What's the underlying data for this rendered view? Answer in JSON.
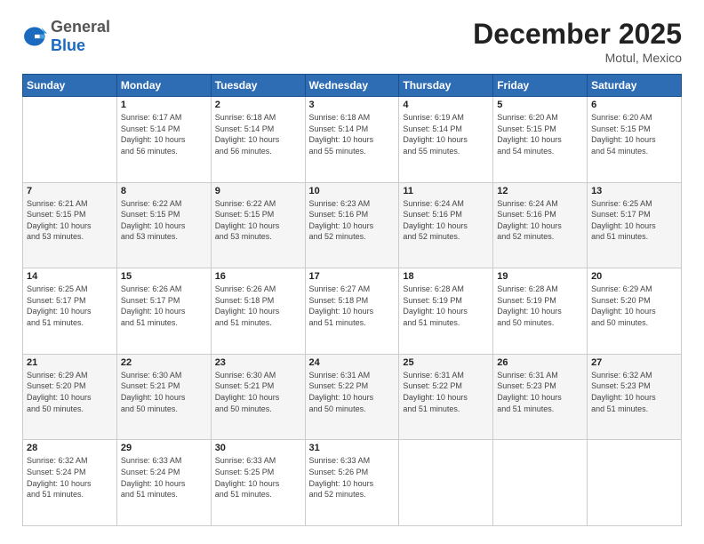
{
  "header": {
    "logo": {
      "general": "General",
      "blue": "Blue"
    },
    "title": "December 2025",
    "subtitle": "Motul, Mexico"
  },
  "weekdays": [
    "Sunday",
    "Monday",
    "Tuesday",
    "Wednesday",
    "Thursday",
    "Friday",
    "Saturday"
  ],
  "weeks": [
    [
      {
        "day": "",
        "info": ""
      },
      {
        "day": "1",
        "info": "Sunrise: 6:17 AM\nSunset: 5:14 PM\nDaylight: 10 hours\nand 56 minutes."
      },
      {
        "day": "2",
        "info": "Sunrise: 6:18 AM\nSunset: 5:14 PM\nDaylight: 10 hours\nand 56 minutes."
      },
      {
        "day": "3",
        "info": "Sunrise: 6:18 AM\nSunset: 5:14 PM\nDaylight: 10 hours\nand 55 minutes."
      },
      {
        "day": "4",
        "info": "Sunrise: 6:19 AM\nSunset: 5:14 PM\nDaylight: 10 hours\nand 55 minutes."
      },
      {
        "day": "5",
        "info": "Sunrise: 6:20 AM\nSunset: 5:15 PM\nDaylight: 10 hours\nand 54 minutes."
      },
      {
        "day": "6",
        "info": "Sunrise: 6:20 AM\nSunset: 5:15 PM\nDaylight: 10 hours\nand 54 minutes."
      }
    ],
    [
      {
        "day": "7",
        "info": "Sunrise: 6:21 AM\nSunset: 5:15 PM\nDaylight: 10 hours\nand 53 minutes."
      },
      {
        "day": "8",
        "info": "Sunrise: 6:22 AM\nSunset: 5:15 PM\nDaylight: 10 hours\nand 53 minutes."
      },
      {
        "day": "9",
        "info": "Sunrise: 6:22 AM\nSunset: 5:15 PM\nDaylight: 10 hours\nand 53 minutes."
      },
      {
        "day": "10",
        "info": "Sunrise: 6:23 AM\nSunset: 5:16 PM\nDaylight: 10 hours\nand 52 minutes."
      },
      {
        "day": "11",
        "info": "Sunrise: 6:24 AM\nSunset: 5:16 PM\nDaylight: 10 hours\nand 52 minutes."
      },
      {
        "day": "12",
        "info": "Sunrise: 6:24 AM\nSunset: 5:16 PM\nDaylight: 10 hours\nand 52 minutes."
      },
      {
        "day": "13",
        "info": "Sunrise: 6:25 AM\nSunset: 5:17 PM\nDaylight: 10 hours\nand 51 minutes."
      }
    ],
    [
      {
        "day": "14",
        "info": "Sunrise: 6:25 AM\nSunset: 5:17 PM\nDaylight: 10 hours\nand 51 minutes."
      },
      {
        "day": "15",
        "info": "Sunrise: 6:26 AM\nSunset: 5:17 PM\nDaylight: 10 hours\nand 51 minutes."
      },
      {
        "day": "16",
        "info": "Sunrise: 6:26 AM\nSunset: 5:18 PM\nDaylight: 10 hours\nand 51 minutes."
      },
      {
        "day": "17",
        "info": "Sunrise: 6:27 AM\nSunset: 5:18 PM\nDaylight: 10 hours\nand 51 minutes."
      },
      {
        "day": "18",
        "info": "Sunrise: 6:28 AM\nSunset: 5:19 PM\nDaylight: 10 hours\nand 51 minutes."
      },
      {
        "day": "19",
        "info": "Sunrise: 6:28 AM\nSunset: 5:19 PM\nDaylight: 10 hours\nand 50 minutes."
      },
      {
        "day": "20",
        "info": "Sunrise: 6:29 AM\nSunset: 5:20 PM\nDaylight: 10 hours\nand 50 minutes."
      }
    ],
    [
      {
        "day": "21",
        "info": "Sunrise: 6:29 AM\nSunset: 5:20 PM\nDaylight: 10 hours\nand 50 minutes."
      },
      {
        "day": "22",
        "info": "Sunrise: 6:30 AM\nSunset: 5:21 PM\nDaylight: 10 hours\nand 50 minutes."
      },
      {
        "day": "23",
        "info": "Sunrise: 6:30 AM\nSunset: 5:21 PM\nDaylight: 10 hours\nand 50 minutes."
      },
      {
        "day": "24",
        "info": "Sunrise: 6:31 AM\nSunset: 5:22 PM\nDaylight: 10 hours\nand 50 minutes."
      },
      {
        "day": "25",
        "info": "Sunrise: 6:31 AM\nSunset: 5:22 PM\nDaylight: 10 hours\nand 51 minutes."
      },
      {
        "day": "26",
        "info": "Sunrise: 6:31 AM\nSunset: 5:23 PM\nDaylight: 10 hours\nand 51 minutes."
      },
      {
        "day": "27",
        "info": "Sunrise: 6:32 AM\nSunset: 5:23 PM\nDaylight: 10 hours\nand 51 minutes."
      }
    ],
    [
      {
        "day": "28",
        "info": "Sunrise: 6:32 AM\nSunset: 5:24 PM\nDaylight: 10 hours\nand 51 minutes."
      },
      {
        "day": "29",
        "info": "Sunrise: 6:33 AM\nSunset: 5:24 PM\nDaylight: 10 hours\nand 51 minutes."
      },
      {
        "day": "30",
        "info": "Sunrise: 6:33 AM\nSunset: 5:25 PM\nDaylight: 10 hours\nand 51 minutes."
      },
      {
        "day": "31",
        "info": "Sunrise: 6:33 AM\nSunset: 5:26 PM\nDaylight: 10 hours\nand 52 minutes."
      },
      {
        "day": "",
        "info": ""
      },
      {
        "day": "",
        "info": ""
      },
      {
        "day": "",
        "info": ""
      }
    ]
  ]
}
